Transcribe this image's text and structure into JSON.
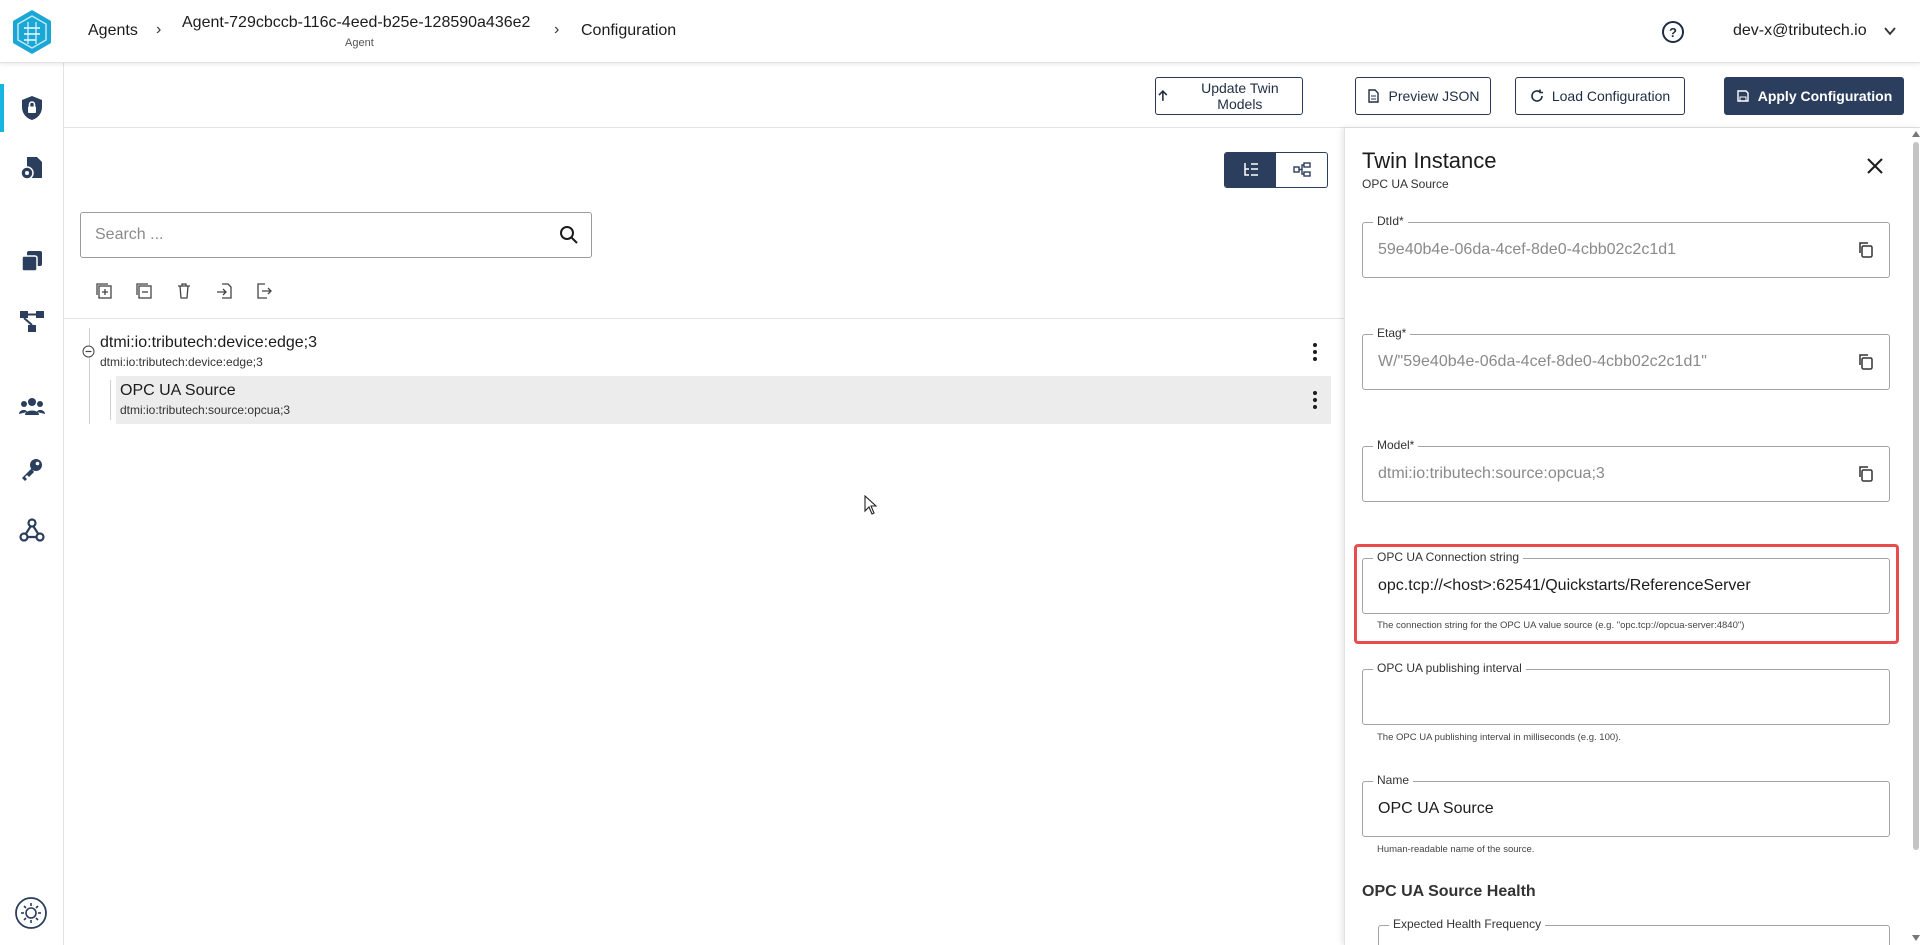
{
  "header": {
    "breadcrumb": [
      {
        "label": "Agents"
      },
      {
        "label": "Agent-729cbccb-116c-4eed-b25e-128590a436e2",
        "sub": "Agent"
      },
      {
        "label": "Configuration"
      }
    ],
    "user": "dev-x@tributech.io"
  },
  "sidebar": {
    "items": [
      {
        "icon": "shield-lock-icon",
        "active": true
      },
      {
        "icon": "document-gear-icon",
        "active": false
      },
      {
        "icon": "stack-icon",
        "active": false
      },
      {
        "icon": "network-icon",
        "active": false
      },
      {
        "icon": "users-icon",
        "active": false
      },
      {
        "icon": "key-icon",
        "active": false
      },
      {
        "icon": "webhook-icon",
        "active": false
      }
    ],
    "theme_icon": "sun-icon"
  },
  "toolbar": {
    "update_twin_models": "Update Twin Models",
    "preview_json": "Preview JSON",
    "load_configuration": "Load Configuration",
    "apply_configuration": "Apply Configuration"
  },
  "search": {
    "placeholder": "Search ..."
  },
  "tree": {
    "root": {
      "title": "dtmi:io:tributech:device:edge;3",
      "sub": "dtmi:io:tributech:device:edge;3"
    },
    "child": {
      "title": "OPC UA Source",
      "sub": "dtmi:io:tributech:source:opcua;3"
    }
  },
  "panel": {
    "title": "Twin Instance",
    "subtitle": "OPC UA Source",
    "fields": {
      "dtid": {
        "label": "DtId*",
        "value": "59e40b4e-06da-4cef-8de0-4cbb02c2c1d1"
      },
      "etag": {
        "label": "Etag*",
        "value": "W/\"59e40b4e-06da-4cef-8de0-4cbb02c2c1d1\""
      },
      "model": {
        "label": "Model*",
        "value": "dtmi:io:tributech:source:opcua;3"
      },
      "connection": {
        "label": "OPC UA Connection string",
        "value": "opc.tcp://<host>:62541/Quickstarts/ReferenceServer",
        "helper": "The connection string for the OPC UA value source (e.g. \"opc.tcp://opcua-server:4840\")"
      },
      "interval": {
        "label": "OPC UA publishing interval",
        "value": "",
        "helper": "The OPC UA publishing interval in milliseconds (e.g. 100)."
      },
      "name": {
        "label": "Name",
        "value": "OPC UA Source",
        "helper": "Human-readable name of the source."
      }
    },
    "health_section": "OPC UA Source Health",
    "health_field": {
      "label": "Expected Health Frequency"
    }
  },
  "colors": {
    "accent": "#18b5e0",
    "primary": "#2b3e5d",
    "highlight": "#e84c4c"
  }
}
